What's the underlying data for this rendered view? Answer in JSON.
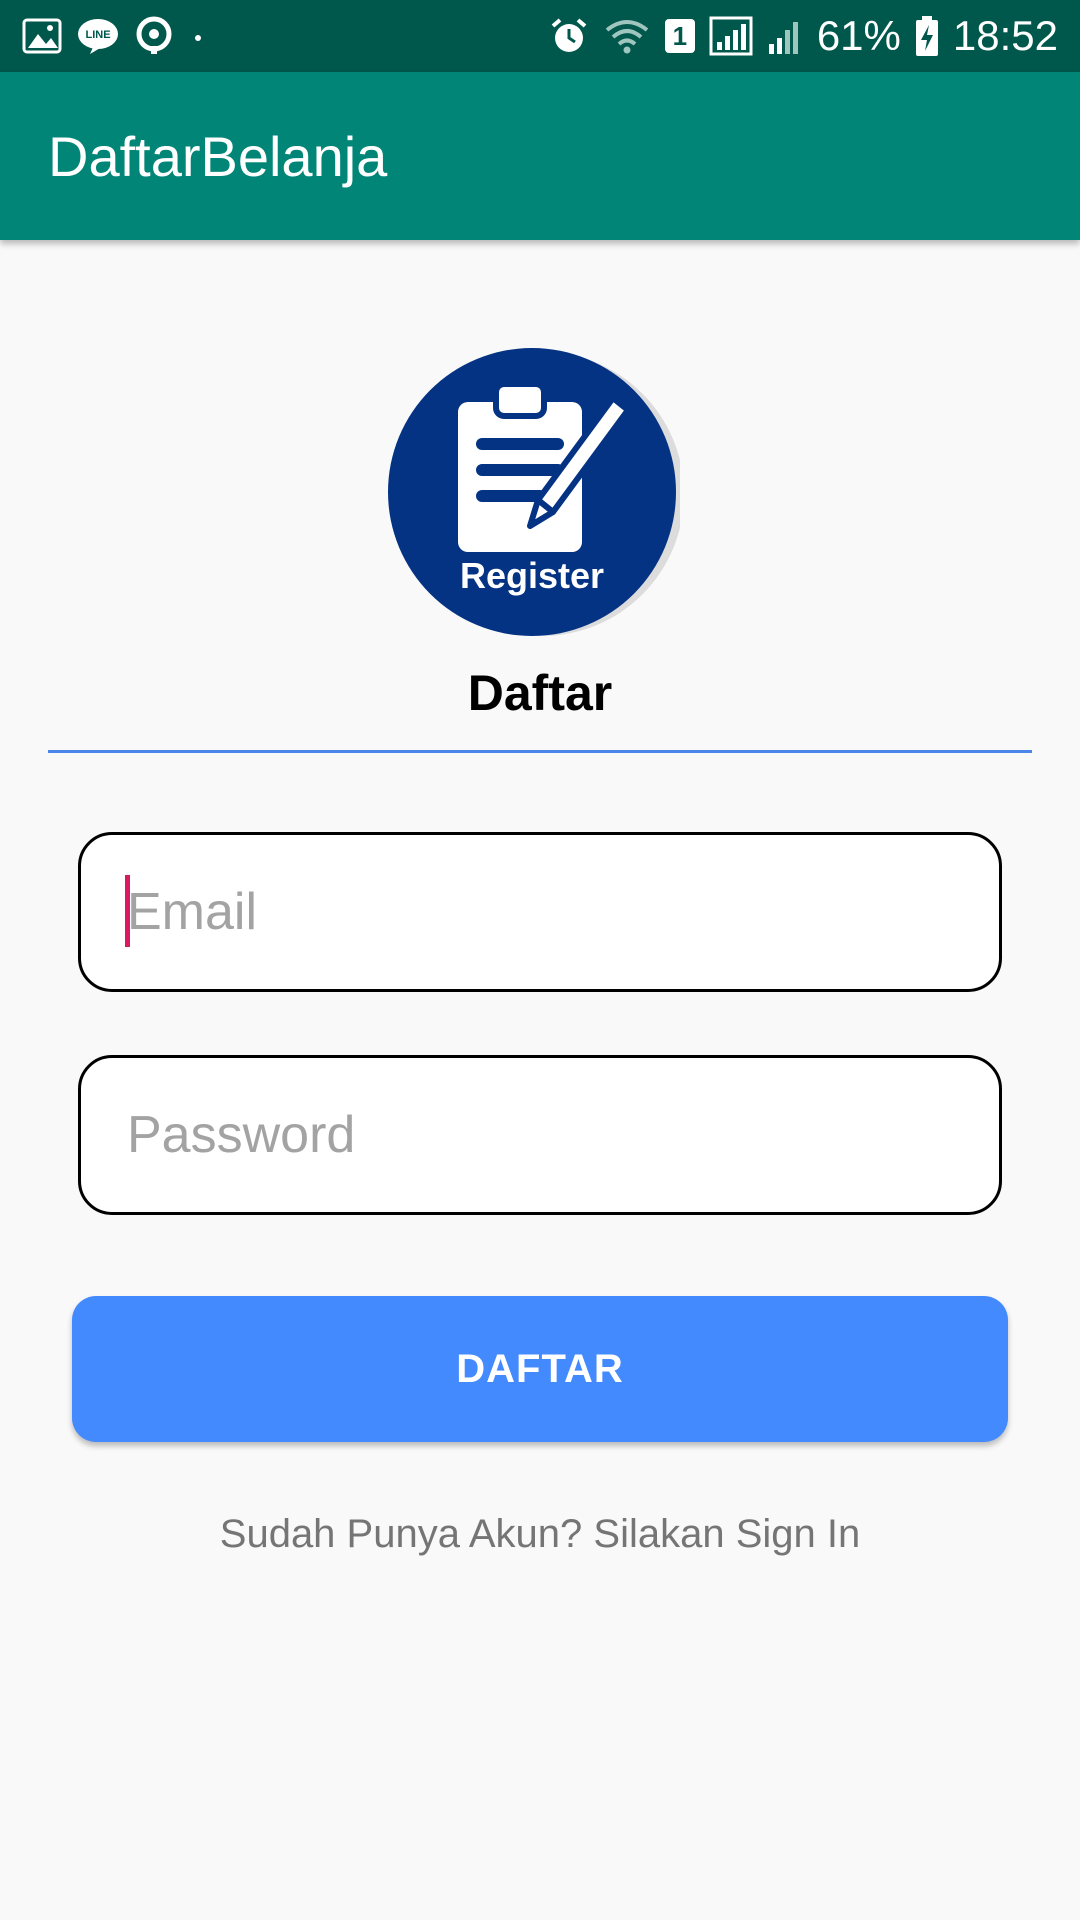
{
  "status_bar": {
    "sim_slot": "1",
    "battery_percent": "61%",
    "time": "18:52"
  },
  "app_bar": {
    "title": "DaftarBelanja"
  },
  "logo": {
    "label": "Register",
    "color": "#053383"
  },
  "form": {
    "section_title": "Daftar",
    "email_placeholder": "Email",
    "email_value": "",
    "password_placeholder": "Password",
    "password_value": "",
    "submit_label": "DAFTAR",
    "signin_link": "Sudah Punya Akun? Silakan Sign In"
  },
  "colors": {
    "status_bar": "#00574b",
    "app_bar": "#008577",
    "button": "#448aff",
    "divider": "#4a86e8",
    "caret": "#d81b60"
  }
}
